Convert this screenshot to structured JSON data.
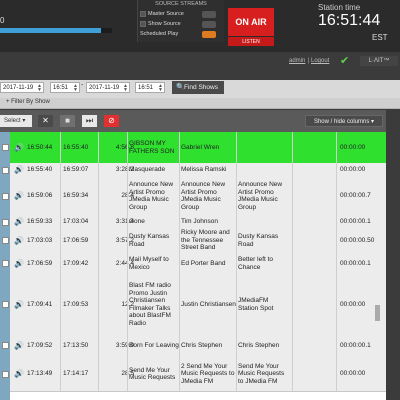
{
  "header": {
    "progress_label": "0",
    "progress_fraction": 0.9,
    "source_streams": {
      "title": "SOURCE STREAMS",
      "items": [
        {
          "label": "Master Source",
          "on": false
        },
        {
          "label": "Show Source",
          "on": false
        },
        {
          "label": "Scheduled Play",
          "on": true
        }
      ]
    },
    "on_air_label": "ON AIR",
    "listen_label": "LISTEN",
    "station_time_label": "Station time",
    "clock": "16:51:44",
    "timezone": "EST",
    "user": "admin",
    "separator": "|",
    "logout": "Logout",
    "logo_text": "L·ΛIT™"
  },
  "filter": {
    "from_date": "2017-11-19",
    "from_time": "16:51",
    "to_date": "2017-11-19",
    "to_time": "16:51",
    "dash": "-",
    "find_label": "Find Shows",
    "filter_by_show": "+ Filter By Show"
  },
  "toolbar": {
    "select_label": "Select ▾",
    "clear_icon": "✕",
    "stop_icon": "■",
    "skip_icon": "⏭",
    "delete_icon": "⊘",
    "columns_label": "Show / hide columns ▾"
  },
  "rows": [
    {
      "start": "16:50:44",
      "end": "16:55:40",
      "duration": "4:56.8",
      "title": "GIBSON MY FATHERS SON",
      "artist": "Gabriel Wren",
      "album": "",
      "cue": "00:00:00",
      "highlight": true
    },
    {
      "start": "16:55:40",
      "end": "16:59:07",
      "duration": "3:28.2",
      "title": "Masquerade",
      "artist": "Melissa Ramski",
      "album": "",
      "cue": "00:00:00",
      "highlight": false
    },
    {
      "start": "16:59:06",
      "end": "16:59:34",
      "duration": "28.4",
      "title": "Announce New Artist Promo JMedia Music Group",
      "artist": "Announce New Artist Promo JMedia Music Group",
      "album": "Announce New Artist Promo JMedia Music Group",
      "cue": "00:00:00.7",
      "highlight": false
    },
    {
      "start": "16:59:33",
      "end": "17:03:04",
      "duration": "3:31.4",
      "title": "Gone",
      "artist": "Tim Johnson",
      "album": "",
      "cue": "00:00:00.1",
      "highlight": false
    },
    {
      "start": "17:03:03",
      "end": "17:06:59",
      "duration": "3:57.2",
      "title": "Dusty Kansas Road",
      "artist": "Ricky Moore and the Tennessee Street Band",
      "album": "Dusty Kansas Road",
      "cue": "00:00:00.50",
      "highlight": false
    },
    {
      "start": "17:06:59",
      "end": "17:09:42",
      "duration": "2:44.4",
      "title": "Mail Myself to Mexico",
      "artist": "Ed Porter Band",
      "album": "Better left to Chance",
      "cue": "00:00:00.1",
      "highlight": false
    },
    {
      "start": "17:09:41",
      "end": "17:09:53",
      "duration": "12.2",
      "title": "Blast FM radio Promo Justin Christiansen Filmaker Talks about BlastFM Radio",
      "artist": "Justin Christiansen",
      "album": "JMediaFM Station Spot",
      "cue": "00:00:00",
      "highlight": false
    },
    {
      "start": "17:09:52",
      "end": "17:13:50",
      "duration": "3:59.0",
      "title": "Born For Leaving",
      "artist": "Chris Stephen",
      "album": "Chris Stephen",
      "cue": "00:00:00.1",
      "highlight": false
    },
    {
      "start": "17:13:49",
      "end": "17:14:17",
      "duration": "28.5",
      "title": "Send Me Your Music Requests",
      "artist": "2 Send Me Your Music Requests to JMedia FM",
      "album": "Send Me Your Music Requests to JMedia FM",
      "cue": "00:00:00",
      "highlight": false
    }
  ],
  "icons": {
    "volume": "🔊",
    "check": "✔",
    "search": "🔍"
  }
}
